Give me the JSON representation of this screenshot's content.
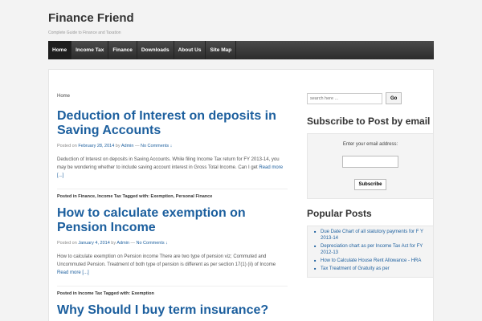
{
  "site": {
    "title": "Finance Friend",
    "description": "Complete Guide to Finance and Taxation"
  },
  "nav": {
    "items": [
      "Home",
      "Income Tax",
      "Finance",
      "Downloads",
      "About Us",
      "Site Map"
    ]
  },
  "breadcrumb": "Home",
  "posts": [
    {
      "title": "Deduction of Interest on deposits in Saving Accounts",
      "meta_prefix": "Posted on",
      "date": "February 28, 2014",
      "by": "by",
      "author": "Admin",
      "dash": "—",
      "comments": "No Comments ↓",
      "excerpt": "Deduction of Interest on deposits in Saving Accounts. While filing Income Tax return for FY 2013-14, you may be wondering whether to include saving account interest in Gross Total Income. Can I get",
      "more": "Read more [...]",
      "tags": "Posted in Finance, Income Tax Tagged with: Exemption, Personal Finance"
    },
    {
      "title": "How to calculate exemption on Pension Income",
      "meta_prefix": "Posted on",
      "date": "January 4, 2014",
      "by": "by",
      "author": "Admin",
      "dash": "—",
      "comments": "No Comments ↓",
      "excerpt": "How to calculate exemption on Pension income There are two type of pension viz; Commuted and Uncommuted Pension. Treatment of both type of pension is different as per section 17(1) (ii) of Income",
      "more": "Read more [...]",
      "tags": "Posted in Income Tax Tagged with: Exemption"
    },
    {
      "title": "Why Should I buy term insurance?"
    }
  ],
  "sidebar": {
    "search_placeholder": "search here ...",
    "search_button": "Go",
    "subscribe_title": "Subscribe to Post by email",
    "subscribe_label": "Enter your email address:",
    "subscribe_button": "Subscribe",
    "popular_title": "Popular Posts",
    "popular": [
      "Due Date Chart of all statutory payments for F Y 2013-14",
      "Depreciation chart as per Income Tax Act for FY 2012-13",
      "How to Calculate House Rent Allowance - HRA",
      "Tax Treatment of Gratuity as per"
    ]
  }
}
